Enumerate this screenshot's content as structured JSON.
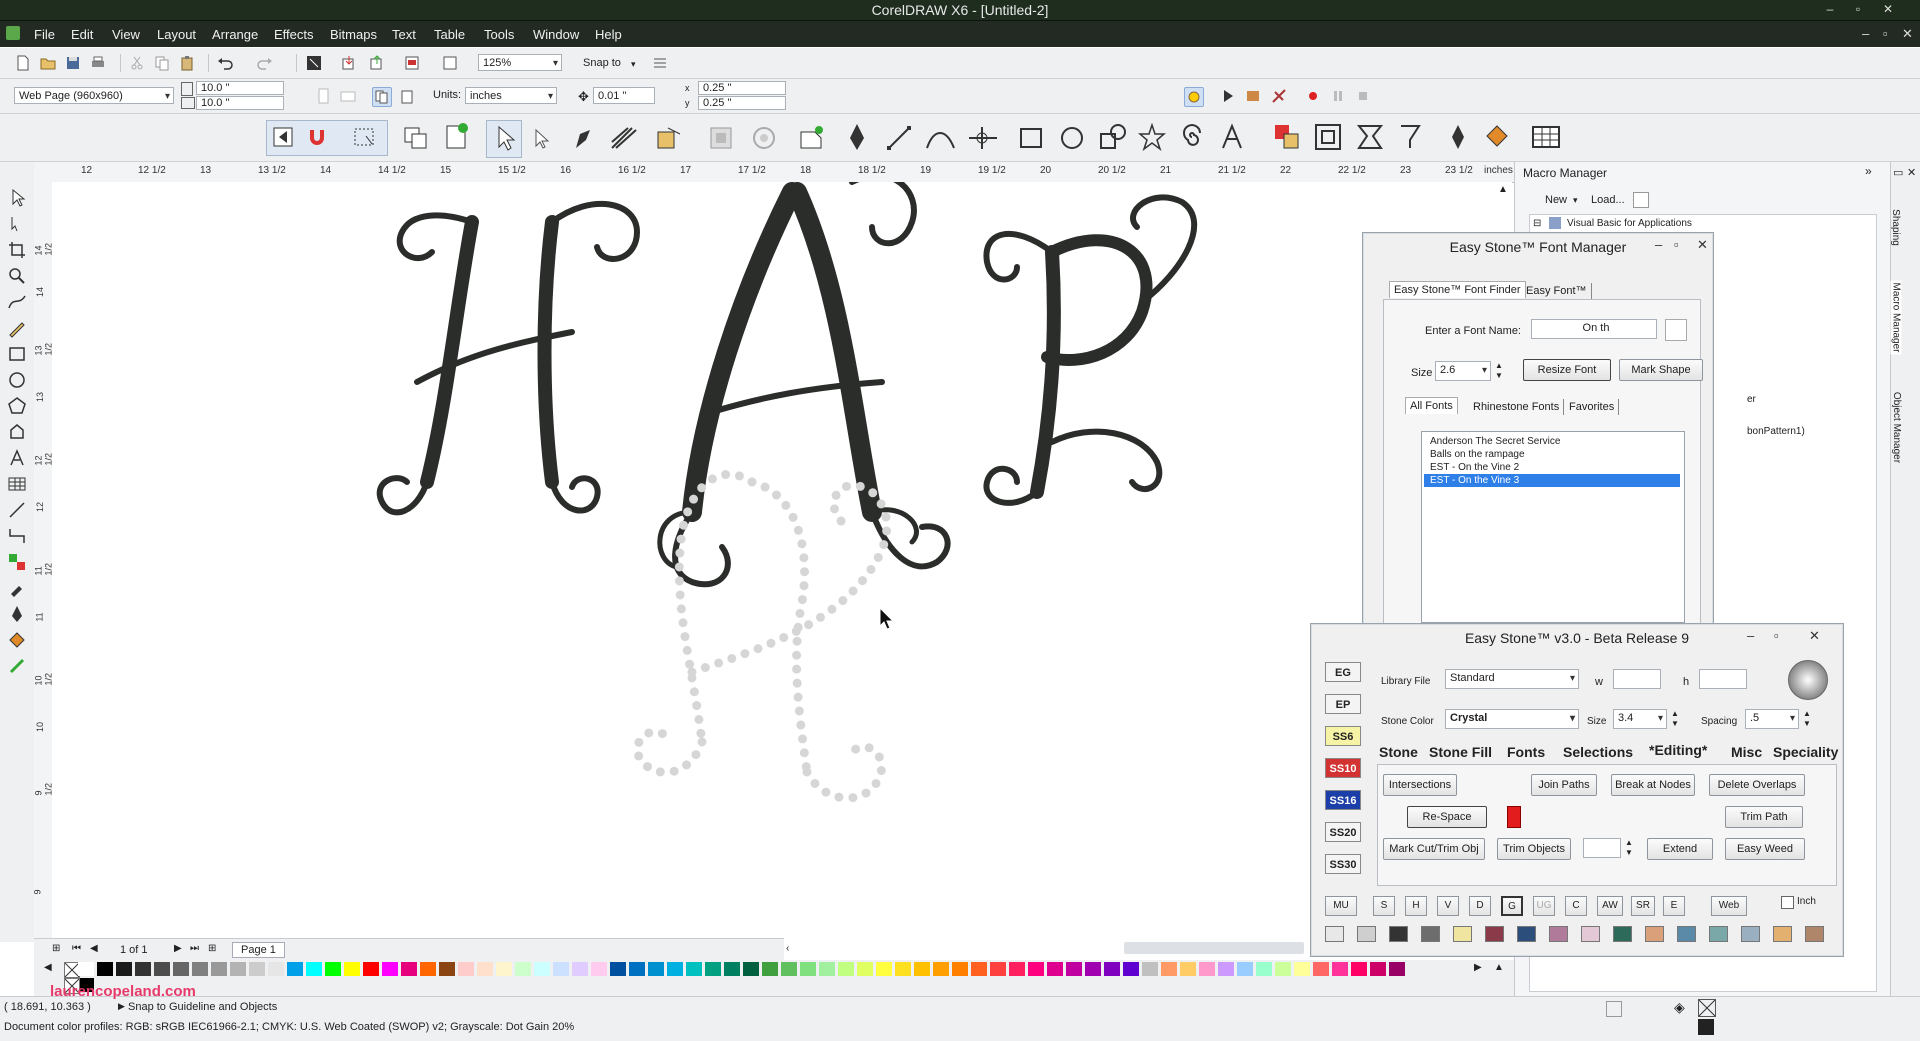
{
  "window": {
    "title": "CorelDRAW X6 - [Untitled-2]"
  },
  "menu": [
    "File",
    "Edit",
    "View",
    "Layout",
    "Arrange",
    "Effects",
    "Bitmaps",
    "Text",
    "Table",
    "Tools",
    "Window",
    "Help"
  ],
  "toolbar": {
    "zoom": "125%",
    "snap_to": "Snap to",
    "page_preset": "Web Page (960x960)",
    "width": "10.0 \"",
    "height": "10.0 \"",
    "units_label": "Units:",
    "units": "inches",
    "nudge": "0.01 \"",
    "dup_x": "0.25 \"",
    "dup_y": "0.25 \""
  },
  "ruler": {
    "ticks": [
      "12",
      "12 1/2",
      "13",
      "13 1/2",
      "14",
      "14 1/2",
      "15",
      "15 1/2",
      "16",
      "16 1/2",
      "17",
      "17 1/2",
      "18",
      "18 1/2",
      "19",
      "19 1/2",
      "20",
      "20 1/2",
      "21",
      "21 1/2",
      "22",
      "22 1/2",
      "23",
      "23 1/2"
    ],
    "unit": "inches",
    "vticks": [
      "14 1/2",
      "14",
      "13 1/2",
      "13",
      "12 1/2",
      "12",
      "11 1/2",
      "11",
      "10 1/2",
      "10",
      "9 1/2",
      "9"
    ]
  },
  "macro_manager": {
    "title": "Macro Manager",
    "new": "New",
    "load": "Load...",
    "tree_item": "Visual Basic for Applications",
    "partial_1": "er",
    "partial_2": "bonPattern1)"
  },
  "side_tabs": {
    "shaping": "Shaping",
    "macro": "Macro Manager",
    "object": "Object Manager"
  },
  "font_manager": {
    "title": "Easy Stone™ Font Manager",
    "tab_finder": "Easy Stone™ Font Finder",
    "tab_easyfont": "Easy Font™",
    "enter_label": "Enter a Font Name:",
    "font_name": "On th",
    "size_label": "Size",
    "size": "2.6",
    "resize_btn": "Resize Font",
    "mark_btn": "Mark Shape",
    "subtab_all": "All Fonts",
    "subtab_rhine": "Rhinestone Fonts",
    "subtab_fav": "Favorites",
    "fonts": [
      "Anderson The Secret Service",
      "Balls on the rampage",
      "EST - On the Vine 2",
      "EST - On the Vine 3"
    ],
    "selected_index": 3
  },
  "easystone": {
    "title": "Easy Stone™ v3.0 - Beta Release 9",
    "side_buttons": [
      {
        "label": "EG",
        "bg": "#f4f4f4",
        "fg": "#222"
      },
      {
        "label": "EP",
        "bg": "#f4f4f4",
        "fg": "#222"
      },
      {
        "label": "SS6",
        "bg": "#f7f3a6",
        "fg": "#222"
      },
      {
        "label": "SS10",
        "bg": "#d23232",
        "fg": "#ffffff"
      },
      {
        "label": "SS16",
        "bg": "#1c3ea8",
        "fg": "#ffffff"
      },
      {
        "label": "SS20",
        "bg": "#f4f4f4",
        "fg": "#222"
      },
      {
        "label": "SS30",
        "bg": "#f4f4f4",
        "fg": "#222"
      }
    ],
    "library_label": "Library File",
    "library": "Standard",
    "w_label": "w",
    "h_label": "h",
    "stone_color_label": "Stone Color",
    "stone_color": "Crystal",
    "size_label": "Size",
    "size": "3.4",
    "spacing_label": "Spacing",
    "spacing": ".5",
    "tabs": [
      "Stone",
      "Stone Fill",
      "Fonts",
      "Selections",
      "*Editing*",
      "Misc",
      "Speciality"
    ],
    "buttons": {
      "intersections": "Intersections",
      "join_paths": "Join Paths",
      "break_nodes": "Break at Nodes",
      "delete_overlaps": "Delete Overlaps",
      "respace": "Re-Space",
      "trim_path": "Trim Path",
      "mark_cut": "Mark Cut/Trim Obj",
      "trim_objects": "Trim Objects",
      "extend": "Extend",
      "easy_weed": "Easy Weed"
    },
    "bottom_buttons": [
      "MU",
      "S",
      "H",
      "V",
      "D",
      "G",
      "UG",
      "C",
      "AW",
      "SR",
      "E"
    ],
    "web": "Web",
    "inch": "Inch",
    "swatches": [
      "#e8e8e8",
      "#cfcfcf",
      "#333333",
      "#6d6d6d",
      "#efe5a0",
      "#8a3a48",
      "#2c4e7a",
      "#b07a9a",
      "#e5c8d6",
      "#2e6a5a",
      "#d9a07a",
      "#5a8aa8",
      "#7aa8a8",
      "#9ab0c0",
      "#e3b070",
      "#b0866a"
    ]
  },
  "page_nav": {
    "counter": "1 of 1",
    "page": "Page 1"
  },
  "palette": [
    "#ffffff",
    "#000000",
    "#1a1a1a",
    "#333333",
    "#4d4d4d",
    "#666666",
    "#808080",
    "#999999",
    "#b3b3b3",
    "#cccccc",
    "#e6e6e6",
    "#00a0e9",
    "#00ffff",
    "#00ff00",
    "#ffff00",
    "#ff0000",
    "#ff00ff",
    "#e6007e",
    "#ff6600",
    "#8b4513",
    "#ffcccc",
    "#ffe0cc",
    "#fff5cc",
    "#ccffcc",
    "#ccffff",
    "#cce0ff",
    "#e0ccff",
    "#ffccf0",
    "#0050a0",
    "#0070c0",
    "#0090d0",
    "#00b0e0",
    "#00c0c0",
    "#00a080",
    "#008060",
    "#006040",
    "#40a040",
    "#60c060",
    "#80e080",
    "#a0f0a0",
    "#c0ff80",
    "#e0ff60",
    "#ffff40",
    "#ffe020",
    "#ffc000",
    "#ffa000",
    "#ff8000",
    "#ff6020",
    "#ff4040",
    "#ff2060",
    "#ff0080",
    "#e00090",
    "#c000a0",
    "#a000b0",
    "#8000c0",
    "#6000d0",
    "#c0c0c0",
    "#ff9966",
    "#ffcc66",
    "#ff99cc",
    "#cc99ff",
    "#99ccff",
    "#99ffcc",
    "#ccff99",
    "#ffff99",
    "#ff6666",
    "#ff3399",
    "#ff0066",
    "#cc0066",
    "#990066"
  ],
  "status": {
    "watermark": "laurencopeland.com",
    "coords": "( 18.691, 10.363 )",
    "snap": "Snap to Guideline and Objects",
    "profiles": "Document color profiles: RGB: sRGB IEC61966-2.1; CMYK: U.S. Web Coated (SWOP) v2; Grayscale: Dot Gain 20%"
  }
}
